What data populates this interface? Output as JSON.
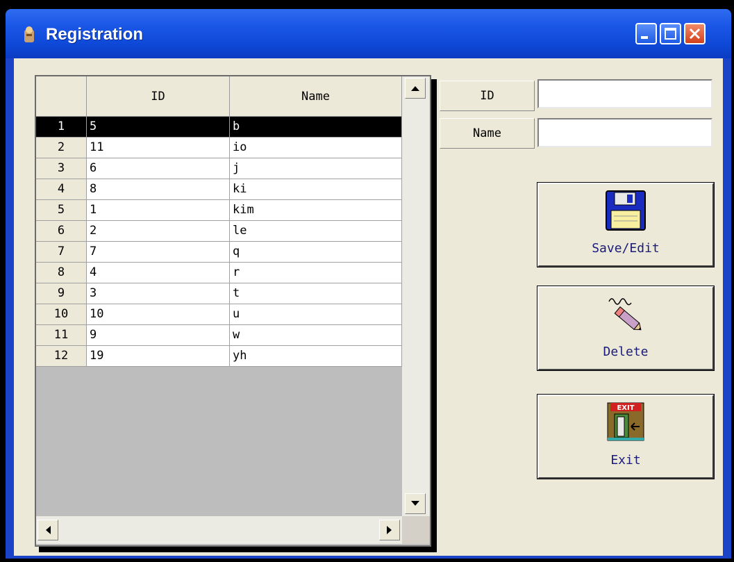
{
  "window": {
    "title": "Registration"
  },
  "grid": {
    "columns": [
      "ID",
      "Name"
    ],
    "rows": [
      {
        "num": "1",
        "id": "5",
        "name": "b"
      },
      {
        "num": "2",
        "id": "11",
        "name": "io"
      },
      {
        "num": "3",
        "id": "6",
        "name": "j"
      },
      {
        "num": "4",
        "id": "8",
        "name": "ki"
      },
      {
        "num": "5",
        "id": "1",
        "name": "kim"
      },
      {
        "num": "6",
        "id": "2",
        "name": "le"
      },
      {
        "num": "7",
        "id": "7",
        "name": "q"
      },
      {
        "num": "8",
        "id": "4",
        "name": "r"
      },
      {
        "num": "9",
        "id": "3",
        "name": "t"
      },
      {
        "num": "10",
        "id": "10",
        "name": "u"
      },
      {
        "num": "11",
        "id": "9",
        "name": "w"
      },
      {
        "num": "12",
        "id": "19",
        "name": "yh"
      }
    ],
    "selected_row": "1"
  },
  "form": {
    "id_label": "ID",
    "id_value": "",
    "name_label": "Name",
    "name_value": ""
  },
  "buttons": {
    "save_label": "Save/Edit",
    "delete_label": "Delete",
    "exit_label": "Exit"
  },
  "colors": {
    "titlebar": "#0a3cc2",
    "selection": "#000000",
    "button_text": "#1a1a7a"
  }
}
